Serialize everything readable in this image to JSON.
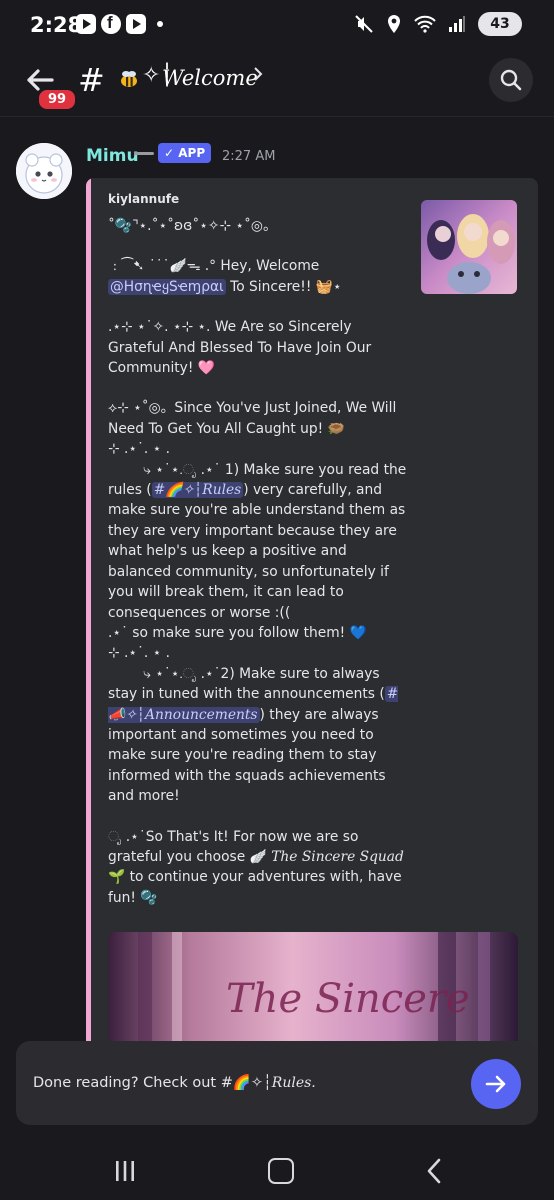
{
  "status_bar": {
    "time": "2:28",
    "battery": "43",
    "app_icons": [
      "youtube-icon",
      "facebook-icon",
      "youtube-icon"
    ],
    "right_icons": [
      "mute-icon",
      "location-icon",
      "wifi-icon",
      "signal-icon"
    ]
  },
  "header": {
    "badge": "99",
    "hash": "#",
    "channel_name": "Welcome",
    "channel_emoji": "bee-icon",
    "channel_diamond": "✧┆"
  },
  "message": {
    "author": "Mimu",
    "app_tag": "✓ APP",
    "timestamp": "2:27 AM",
    "embed": {
      "author": "kiylannufe",
      "line_deco": "˚🫧⌝⋆.˚⋆˚ʚɞ˚⋆✧⊹ ⋆˚◎。",
      "hey_prefix": "﹕⁀➷ ˙˙˙🪽ᯓ .° Hey, Welcome",
      "mention": "@HσɳҽყSҽɱραι",
      "to_sincere": " To Sincere!! 🧺⋆",
      "grateful": ".⋆⊹ ⋆˙✧. ⋆⊹ ⋆. We Are so Sincerely Grateful And Blessed To Have Join Our Community! 🩷",
      "joined": "⟡⊹ ⋆˚◎。Since You've Just Joined, We Will Need To Get You All Caught up! 🪹",
      "deco_dots_1": "⊹ .⋆˙. ⋆ .",
      "rule1_prefix": "        ⤷ ⋆˙⋆.ೃ .⋆˙ 1) Make sure you read the rules (",
      "rules_channel": "#🌈✧┆Rules",
      "rule1_body": ") very carefully, and make sure you're able understand them as they are very important because they are what help's us keep a positive and balanced community, so unfortunately if you will break them, it can lead to consequences or worse :((",
      "rule1_follow": ".⋆˙ so make sure you follow them! 💙",
      "deco_dots_2": "⊹ .⋆˙. ⋆ .",
      "rule2_prefix": "        ⤷ ⋆˙⋆.ೃ .⋆˙2) Make sure to always stay in tuned with the announcements (",
      "announce_channel": "#📣✧┆Announcements",
      "rule2_body": ") they are always important and sometimes you need to make sure you're reading them to stay informed with the squads achievements and more!",
      "outro_start": "ೃ .⋆˙So That's It! For now we are so grateful you choose 🪽 ",
      "squad_name": "The Sincere Squad",
      "outro_end": " 🌱 to continue your adventures with, have fun! 🫧",
      "banner_text": "The Sincere"
    }
  },
  "composer": {
    "prompt": "Done reading? Check out #🌈✧┆",
    "channel": "Rules."
  },
  "colors": {
    "background": "#1a1a1e",
    "embed_accent": "#f1a9d3",
    "author": "#7fe8de",
    "blurple": "#5865f2",
    "badge_red": "#e0313f"
  }
}
